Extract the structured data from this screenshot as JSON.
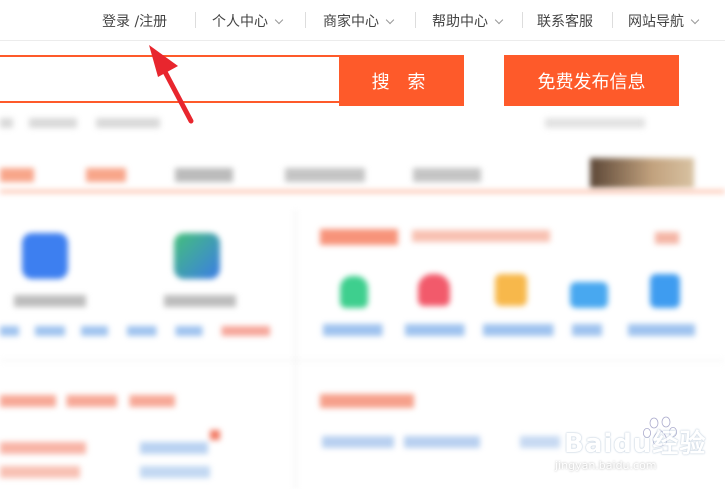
{
  "topnav": {
    "login": "登录 /注册",
    "items": [
      {
        "label": "个人中心"
      },
      {
        "label": "商家中心"
      },
      {
        "label": "帮助中心"
      },
      {
        "label": "联系客服"
      },
      {
        "label": "网站导航"
      }
    ]
  },
  "search": {
    "button_label": "搜 索",
    "publish_label": "免费发布信息"
  },
  "watermark": {
    "brand": "Baidu经验",
    "url": "jingyan.baidu.com"
  },
  "colors": {
    "accent": "#fe5a2a",
    "annotation_arrow": "#e8262e"
  }
}
